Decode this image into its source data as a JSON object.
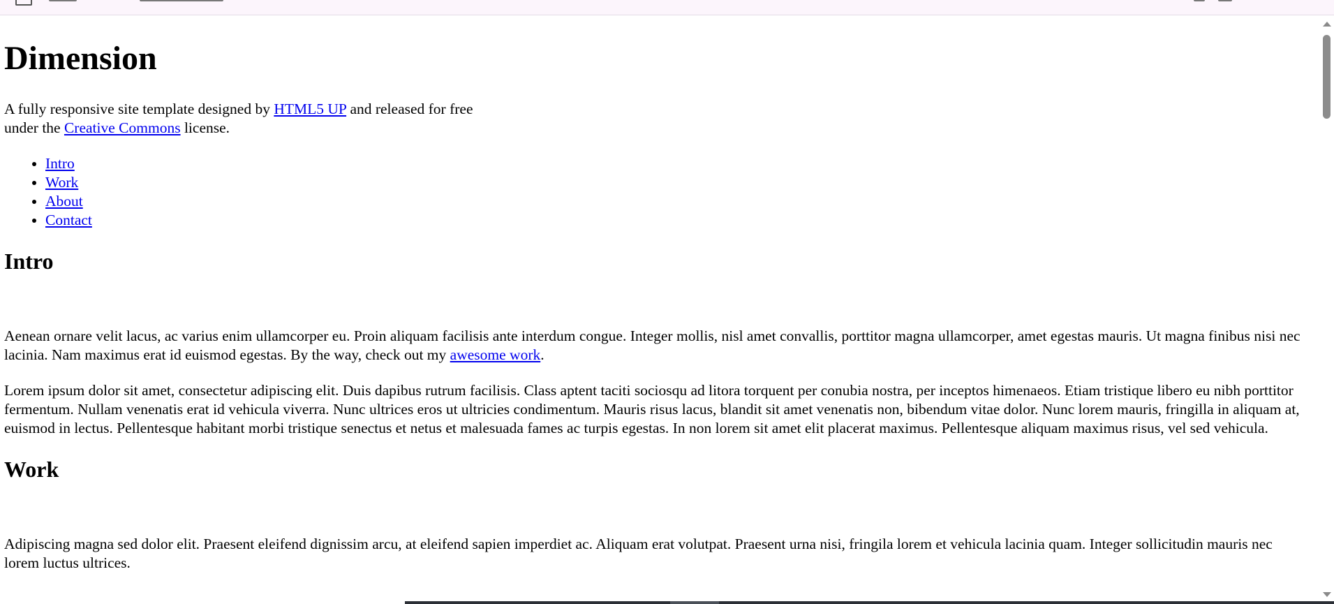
{
  "header": {
    "title": "Dimension",
    "tagline_before_link1": "A fully responsive site template designed by ",
    "tagline_link1": "HTML5 UP",
    "tagline_between": " and released for free under the ",
    "tagline_link2": "Creative Commons",
    "tagline_after": " license."
  },
  "nav": {
    "items": [
      "Intro",
      "Work",
      "About",
      "Contact"
    ]
  },
  "intro": {
    "heading": "Intro",
    "paragraph1_text": "Aenean ornare velit lacus, ac varius enim ullamcorper eu. Proin aliquam facilisis ante interdum congue. Integer mollis, nisl amet convallis, porttitor magna ullamcorper, amet egestas mauris. Ut magna finibus nisi nec lacinia. Nam maximus erat id euismod egestas. By the way, check out my ",
    "paragraph1_link": "awesome work",
    "paragraph1_end": ".",
    "paragraph2": "Lorem ipsum dolor sit amet, consectetur adipiscing elit. Duis dapibus rutrum facilisis. Class aptent taciti sociosqu ad litora torquent per conubia nostra, per inceptos himenaeos. Etiam tristique libero eu nibh porttitor fermentum. Nullam venenatis erat id vehicula viverra. Nunc ultrices eros ut ultricies condimentum. Mauris risus lacus, blandit sit amet venenatis non, bibendum vitae dolor. Nunc lorem mauris, fringilla in aliquam at, euismod in lectus. Pellentesque habitant morbi tristique senectus et netus et malesuada fames ac turpis egestas. In non lorem sit amet elit placerat maximus. Pellentesque aliquam maximus risus, vel sed vehicula."
  },
  "work": {
    "heading": "Work",
    "paragraph1": "Adipiscing magna sed dolor elit. Praesent eleifend dignissim arcu, at eleifend sapien imperdiet ac. Aliquam erat volutpat. Praesent urna nisi, fringila lorem et vehicula lacinia quam. Integer sollicitudin mauris nec lorem luctus ultrices."
  },
  "colors": {
    "link": "#0000ee",
    "top_strip": "#fcf5fc",
    "scrollbar_thumb": "#8c8c8c"
  },
  "icons": {
    "top_strip_icon": "apps-icon",
    "scroll_up": "arrow-up-icon",
    "scroll_down": "arrow-down-icon"
  }
}
